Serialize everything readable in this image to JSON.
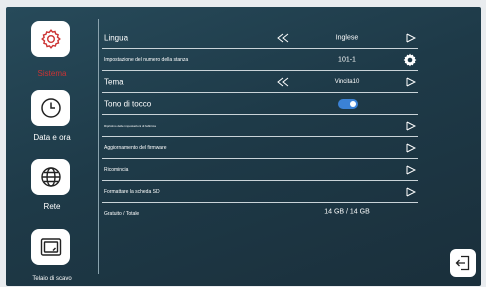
{
  "sidebar": {
    "items": [
      {
        "label": "Sistema",
        "icon": "gear-icon",
        "selected": true
      },
      {
        "label": "Data e ora",
        "icon": "clock-icon",
        "selected": false
      },
      {
        "label": "Rete",
        "icon": "globe-icon",
        "selected": false
      },
      {
        "label": "Telaio di scavo",
        "icon": "frame-icon",
        "selected": false
      }
    ]
  },
  "settings": {
    "language": {
      "label": "Lingua",
      "value": "Inglese"
    },
    "room_number": {
      "label": "Impostazione del numero della stanza",
      "value": "101-1"
    },
    "theme": {
      "label": "Tema",
      "value": "Vincita10"
    },
    "touch_tone": {
      "label": "Tono di tocco",
      "enabled": true
    },
    "restore": {
      "label": "Ripristino delle impostazioni di fabbrica"
    },
    "firmware": {
      "label": "Aggiornamento del firmware"
    },
    "restart": {
      "label": "Ricomincia"
    },
    "format_sd": {
      "label": "Formattare la scheda SD"
    },
    "storage": {
      "label": "Gratuito / Totale",
      "value": "14 GB / 14 GB"
    }
  },
  "colors": {
    "background": "#1e3a48",
    "selected_accent": "#cc3333",
    "toggle_on": "#3b82d6"
  }
}
